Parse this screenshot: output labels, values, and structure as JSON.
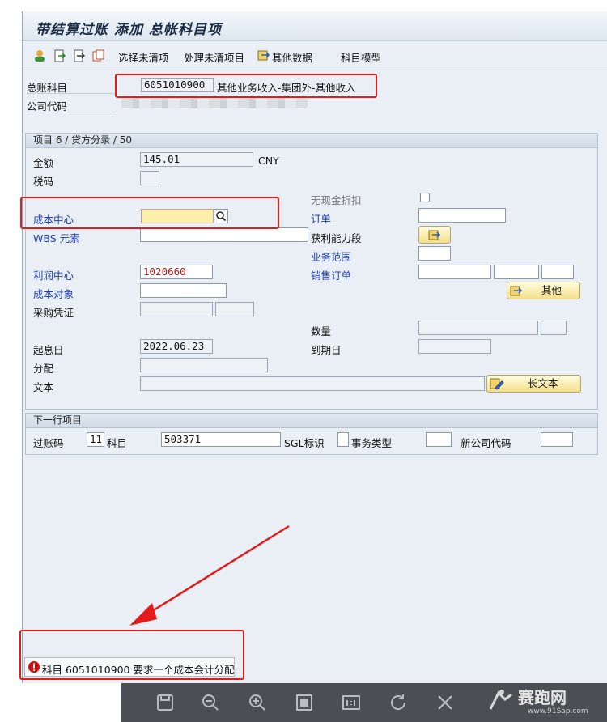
{
  "window": {
    "title": "带结算过账 添加 总帐科目项"
  },
  "toolbar": {
    "choose_open": "选择未清项",
    "process_open": "处理未清项目",
    "other_data": "其他数据",
    "account_model": "科目模型"
  },
  "header": {
    "gl_label": "总账科目",
    "gl_number": "6051010900",
    "gl_desc": "其他业务收入-集团外-其他收入",
    "company_label": "公司代码"
  },
  "item": {
    "group_title": "项目 6 / 贷方分录 / 50",
    "amount_label": "金额",
    "amount_value": "145.01",
    "currency": "CNY",
    "tax_label": "税码",
    "cash_discount_label": "无现金折扣",
    "cost_center_label": "成本中心",
    "order_label": "订单",
    "wbs_label": "WBS 元素",
    "profit_segment_label": "获利能力段",
    "business_area_label": "业务范围",
    "profit_center_label": "利润中心",
    "profit_center_value": "1020660",
    "sales_order_label": "销售订单",
    "cost_object_label": "成本对象",
    "more_button": "其他",
    "purchasing_doc_label": "采购凭证",
    "quantity_label": "数量",
    "value_date_label": "起息日",
    "value_date": "2022.06.23",
    "due_date_label": "到期日",
    "assignment_label": "分配",
    "text_label": "文本",
    "long_text_button": "长文本"
  },
  "next_item": {
    "group_title": "下一行项目",
    "posting_key_label": "过账码",
    "posting_key_value": "11",
    "account_label": "科目",
    "account_value": "503371",
    "sgl_label": "SGL标识",
    "transaction_type_label": "事务类型",
    "new_company_label": "新公司代码"
  },
  "status_bar": {
    "message": "科目 6051010900 要求一个成本会计分配"
  },
  "watermark": {
    "brand": "赛跑网",
    "url": "www.91Sap.com"
  },
  "colors": {
    "highlight_red": "#e41b1b",
    "label_blue": "#1f3fb5",
    "error_red": "#d01010"
  }
}
